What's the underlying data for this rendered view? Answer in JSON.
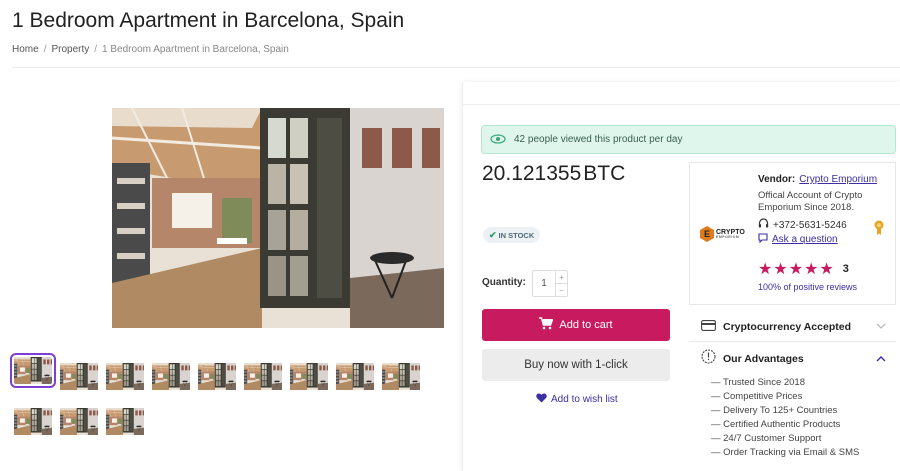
{
  "page": {
    "title": "1 Bedroom Apartment in Barcelona, Spain",
    "breadcrumb": [
      "Home",
      "Property",
      "1 Bedroom Apartment in Barcelona, Spain"
    ]
  },
  "gallery": {
    "thumbnail_count": 12,
    "active_thumbnail": 1
  },
  "product": {
    "views_notice": "42 people viewed this product per day",
    "price": "20.121355",
    "currency": "BTC",
    "stock_status": "IN STOCK",
    "quantity_label": "Quantity:",
    "quantity_value": "1",
    "add_to_cart_label": "Add to cart",
    "buy_now_label": "Buy now with 1-click",
    "wishlist_label": "Add to wish list"
  },
  "vendor": {
    "label": "Vendor:",
    "name": "Crypto Emporium",
    "description": "Offical Account of Crypto Emporium Since 2018.",
    "phone": "+372-5631-5246",
    "ask_label": "Ask a question",
    "rating_stars": 5,
    "rating_count": "3",
    "positive_reviews": "100% of positive reviews",
    "logo_text": "CRYPTO",
    "logo_subtext": "EMPORIUM",
    "logo_letter": "E"
  },
  "accordions": {
    "crypto_title": "Cryptocurrency Accepted",
    "advantages_title": "Our Advantages",
    "advantages": [
      "— Trusted Since 2018",
      "— Competitive Prices",
      "— Delivery To 125+ Countries",
      "— Certified Authentic Products",
      "— 24/7 Customer Support",
      "— Order Tracking via Email & SMS"
    ]
  },
  "colors": {
    "accent": "#c81a5e",
    "link": "#3a2fa3",
    "notice_bg": "#dff6ec",
    "active_thumb": "#7b3fd1"
  },
  "icons": {
    "views": "eye-icon",
    "stock": "check-icon",
    "cart": "cart-icon",
    "wishlist": "heart-icon",
    "phone": "headset-icon",
    "ask": "chat-icon",
    "medal": "medal-icon",
    "crypto": "card-icon",
    "advantages": "alert-circle-icon"
  }
}
